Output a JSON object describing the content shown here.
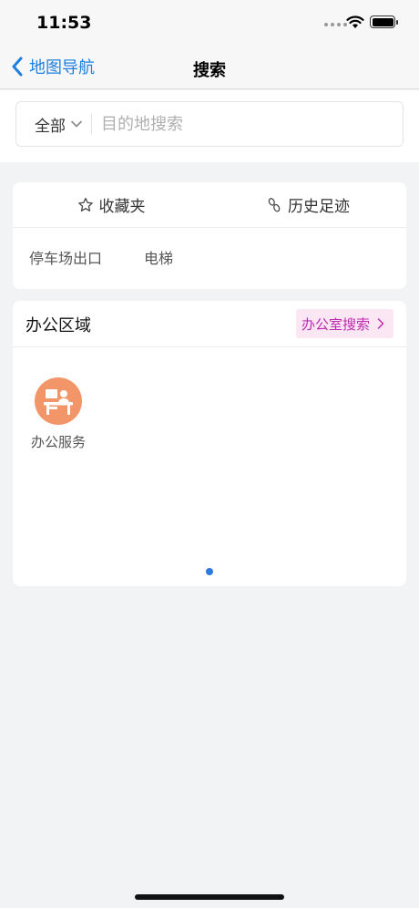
{
  "status_bar": {
    "time": "11:53"
  },
  "nav": {
    "back_label": "地图导航",
    "title": "搜索"
  },
  "search": {
    "scope_label": "全部",
    "placeholder": "目的地搜索"
  },
  "quick_links": {
    "favorites_label": "收藏夹",
    "history_label": "历史足迹",
    "tags": [
      "停车场出口",
      "电梯"
    ]
  },
  "office": {
    "title": "办公区域",
    "search_button_label": "办公室搜索",
    "services": [
      {
        "label": "办公服务",
        "icon": "desk-person-icon"
      }
    ]
  },
  "colors": {
    "accent_blue": "#1d7fe0",
    "office_search_bg": "#fbe6f4",
    "office_search_text": "#c02ab0",
    "service_icon_bg": "#f2966a",
    "page_dot": "#2d7ae0"
  }
}
